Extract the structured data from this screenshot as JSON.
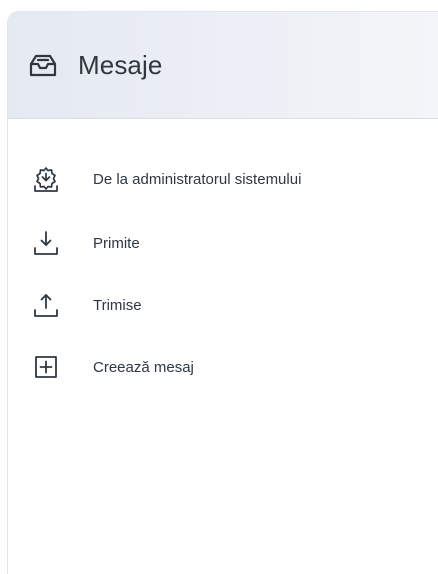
{
  "header": {
    "title": "Mesaje",
    "icon": "message-box-icon"
  },
  "menu": {
    "items": [
      {
        "label": "De la administratorul sistemului",
        "icon": "admin-gear-icon"
      },
      {
        "label": "Primite",
        "icon": "download-arrow-icon"
      },
      {
        "label": "Trimise",
        "icon": "upload-arrow-icon"
      },
      {
        "label": "Creează mesaj",
        "icon": "plus-box-icon"
      }
    ]
  },
  "colors": {
    "text": "#2f3740",
    "header_bg": "#e9ecf3",
    "panel_bg": "#ffffff"
  }
}
